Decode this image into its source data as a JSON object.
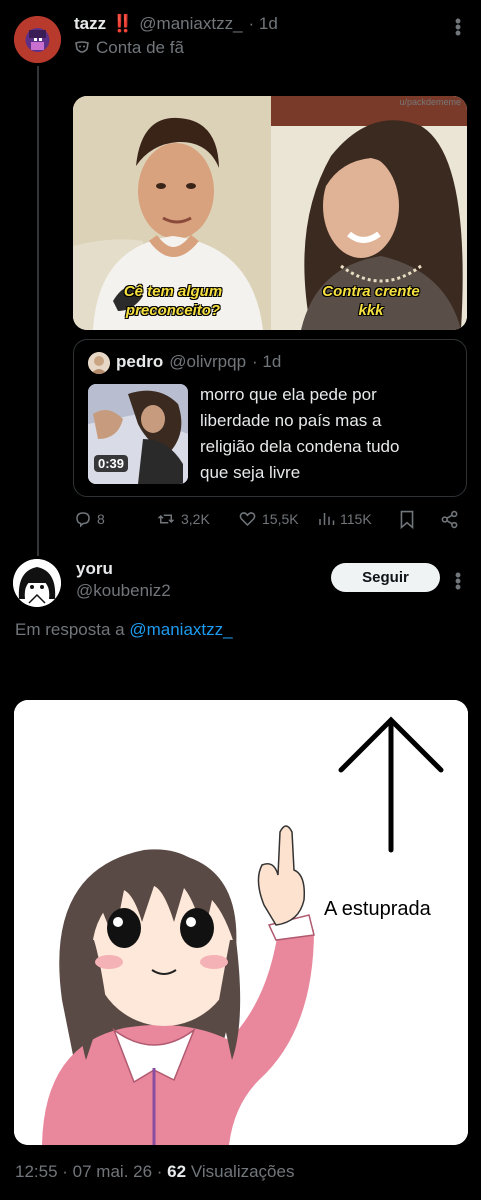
{
  "tweet": {
    "author_name": "tazz",
    "author_badge": "‼️",
    "author_handle": "@maniaxtzz_",
    "time": "· 1d",
    "label": "Conta de fã",
    "media": {
      "caption_left": "Cê tem algum preconceito?",
      "caption_right": "Contra crente kkk",
      "watermark": "u/packdememe"
    },
    "quote": {
      "author_name": "pedro",
      "author_handle": "@olivrpqp",
      "time": "· 1d",
      "text": "morro que ela pede por liberdade no país mas a religião dela condena tudo que seja livre",
      "video_duration": "0:39"
    },
    "actions": {
      "replies": "8",
      "retweets": "3,2K",
      "likes": "15,5K",
      "views": "115K"
    }
  },
  "reply": {
    "author_name": "yoru",
    "author_handle": "@koubeniz2",
    "follow_label": "Seguir",
    "reply_to_prefix": "Em resposta a",
    "reply_to_handle": "@maniaxtzz_",
    "meme_text": "A estuprada",
    "footer": {
      "time": "12:55",
      "date": "· 07 mai. 26 ·",
      "views_count": "62",
      "views_label": "Visualizações"
    }
  },
  "colors": {
    "background": "#000000",
    "text": "#e7e9ea",
    "muted": "#71767b",
    "link": "#1d9bf0",
    "badge": "#f4212e"
  }
}
